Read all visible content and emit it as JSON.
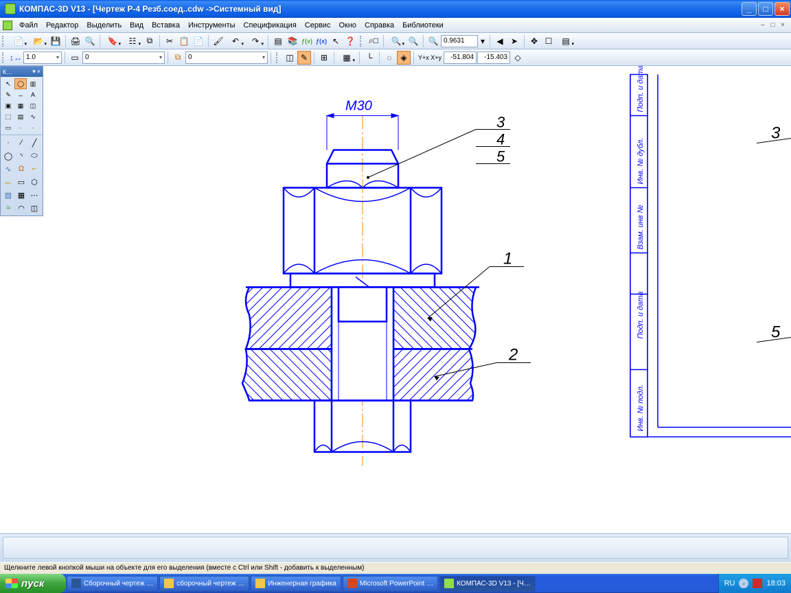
{
  "title": "КОМПАС-3D V13 - [Чертеж Р-4 Резб.соед..cdw ->Системный вид]",
  "menu": [
    "Файл",
    "Редактор",
    "Выделить",
    "Вид",
    "Вставка",
    "Инструменты",
    "Спецификация",
    "Сервис",
    "Окно",
    "Справка",
    "Библиотеки"
  ],
  "zoom_value": "0.9631",
  "coord": {
    "label": "Y+x X+y",
    "x": "-51.804",
    "y": "-15.403"
  },
  "scale_combo": "1.0",
  "cur_style": "0",
  "layer_combo": "0",
  "palette_title": "К…",
  "status": "Щелкните левой кнопкой мыши на объекте для его выделения (вместе с Ctrl или Shift - добавить к выделенным)",
  "drawing": {
    "dim_label": "M30",
    "callouts_right": [
      "3",
      "4",
      "5"
    ],
    "part_labels": [
      "1",
      "2"
    ],
    "sheet_right_marks": [
      "3",
      "5"
    ],
    "titleblock_rows": [
      "Подп. и дата",
      "Инв. № дубл.",
      "Взам. инв №",
      "Подп. и дата",
      "Инв. № подл."
    ]
  },
  "taskbar": {
    "start": "пуск",
    "items": [
      {
        "label": "Сборочный чертеж …",
        "icon": "#2b579a"
      },
      {
        "label": "сборочный чертеж …",
        "icon": "#f3c64a"
      },
      {
        "label": "Инженерная графика",
        "icon": "#f3c64a"
      },
      {
        "label": "Microsoft PowerPoint …",
        "icon": "#d24726"
      },
      {
        "label": "КОМПАС-3D V13 - [Ч…",
        "icon": "#8fdb4a",
        "active": true
      }
    ],
    "lang": "RU",
    "time": "18:03"
  }
}
